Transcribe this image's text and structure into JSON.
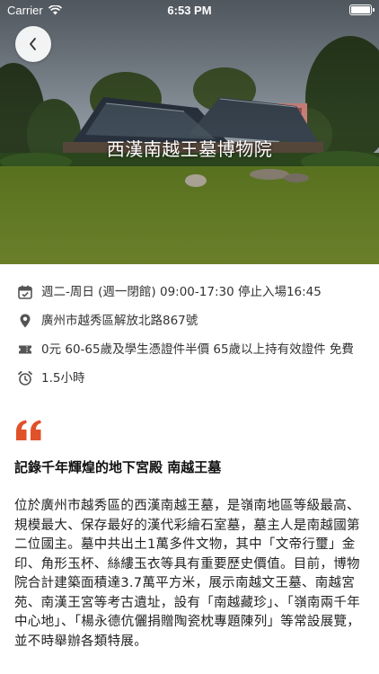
{
  "status_bar": {
    "carrier": "Carrier",
    "time": "6:53 PM"
  },
  "header": {
    "title": "西漢南越王墓博物院"
  },
  "info": {
    "hours": "週二-周日 (週一閉館) 09:00-17:30 停止入場16:45",
    "address": "廣州市越秀區解放北路867號",
    "price": "0元 60-65歲及學生憑證件半價 65歲以上持有效證件 免費",
    "duration": "1.5小時"
  },
  "article": {
    "title": "記錄千年輝煌的地下宮殿 南越王墓",
    "body": "位於廣州市越秀區的西漢南越王墓，是嶺南地區等級最高、規模最大、保存最好的漢代彩繪石室墓，墓主人是南越國第二位國主。墓中共出土1萬多件文物，其中「文帝行璽」金印、角形玉杯、絲縷玉衣等具有重要歷史價值。目前，博物院合計建築面積達3.7萬平方米，展示南越文王墓、南越宮苑、南漢王宮等考古遺址，設有「南越藏珍」、「嶺南兩千年中心地」、「楊永德伉儷捐贈陶瓷枕專題陳列」等常設展覽，並不時舉辦各類特展。"
  },
  "icons": {
    "back": "chevron-left-icon",
    "hours": "calendar-icon",
    "address": "location-pin-icon",
    "price": "ticket-icon",
    "duration": "alarm-clock-icon",
    "quote": "quote-icon"
  },
  "colors": {
    "accent": "#E0522A",
    "icon": "#555555",
    "text": "#222222"
  }
}
